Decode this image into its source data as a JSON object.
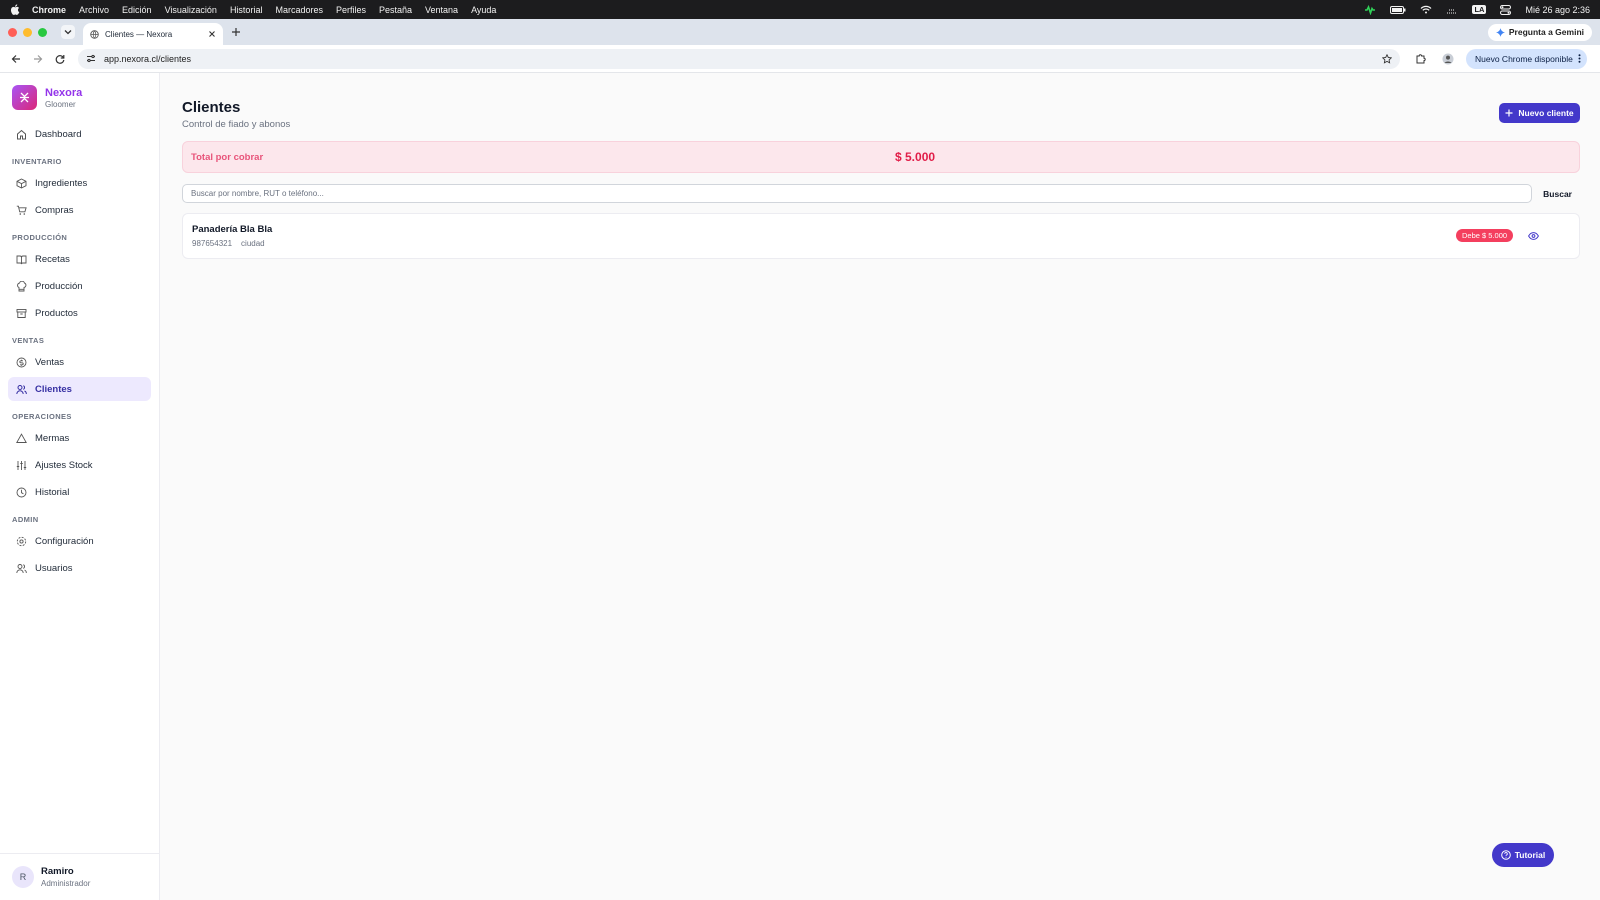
{
  "menubar": {
    "app": "Chrome",
    "items": [
      "Archivo",
      "Edición",
      "Visualización",
      "Historial",
      "Marcadores",
      "Perfiles",
      "Pestaña",
      "Ventana",
      "Ayuda"
    ],
    "input_source": "LA",
    "clock": "Mié 26 ago 2:36"
  },
  "browser": {
    "tab_title": "Clientes — Nexora",
    "gemini_label": "Pregunta a Gemini",
    "url": "app.nexora.cl/clientes",
    "update_label": "Nuevo Chrome disponible"
  },
  "brand": {
    "name": "Nexora",
    "subtitle": "Gloomer"
  },
  "sidebar": {
    "dashboard": "Dashboard",
    "section_inventario": "INVENTARIO",
    "ingredientes": "Ingredientes",
    "compras": "Compras",
    "section_produccion": "PRODUCCIÓN",
    "recetas": "Recetas",
    "produccion": "Producción",
    "productos": "Productos",
    "section_ventas": "VENTAS",
    "ventas": "Ventas",
    "clientes": "Clientes",
    "section_operaciones": "OPERACIONES",
    "mermas": "Mermas",
    "ajustes": "Ajustes Stock",
    "historial": "Historial",
    "section_admin": "ADMIN",
    "configuracion": "Configuración",
    "usuarios": "Usuarios"
  },
  "user": {
    "initial": "R",
    "name": "Ramiro",
    "role": "Administrador"
  },
  "page": {
    "title": "Clientes",
    "subtitle": "Control de fiado y abonos",
    "new_button": "Nuevo cliente",
    "total_label": "Total por cobrar",
    "total_value": "$ 5.000",
    "search_placeholder": "Buscar por nombre, RUT o teléfono...",
    "search_button": "Buscar",
    "tutorial": "Tutorial"
  },
  "clients": [
    {
      "name": "Panadería Bla Bla",
      "phone": "987654321",
      "city": "ciudad",
      "debt": "Debe $ 5.000"
    }
  ],
  "colors": {
    "accent": "#4338ca",
    "brand": "#9333ea",
    "debt": "#f43f5e",
    "total_bg": "#fce7ec"
  }
}
